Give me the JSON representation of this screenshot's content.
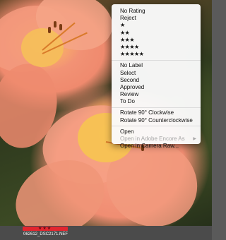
{
  "context_menu": {
    "items": [
      {
        "label": "No Rating",
        "type": "item"
      },
      {
        "label": "Reject",
        "type": "item"
      },
      {
        "label": "★",
        "type": "stars"
      },
      {
        "label": "★★",
        "type": "stars"
      },
      {
        "label": "★★★",
        "type": "stars"
      },
      {
        "label": "★★★★",
        "type": "stars"
      },
      {
        "label": "★★★★★",
        "type": "stars"
      },
      {
        "type": "separator"
      },
      {
        "label": "No Label",
        "type": "item"
      },
      {
        "label": "Select",
        "type": "item"
      },
      {
        "label": "Second",
        "type": "item"
      },
      {
        "label": "Approved",
        "type": "item"
      },
      {
        "label": "Review",
        "type": "item"
      },
      {
        "label": "To Do",
        "type": "item"
      },
      {
        "type": "separator"
      },
      {
        "label": "Rotate 90° Clockwise",
        "type": "item"
      },
      {
        "label": "Rotate 90° Counterclockwise",
        "type": "item"
      },
      {
        "type": "separator"
      },
      {
        "label": "Open",
        "type": "item"
      },
      {
        "label": "Open in Adobe Encore As",
        "type": "item",
        "disabled": true,
        "submenu": true
      },
      {
        "label": "Open in Camera Raw...",
        "type": "item"
      }
    ]
  },
  "thumbnail": {
    "filename": "062612_DSC2171.NEF",
    "rating_stars": "★★★",
    "label_color": "#e3262f"
  },
  "icons": {
    "submenu_arrow": "submenu-arrow-icon"
  }
}
